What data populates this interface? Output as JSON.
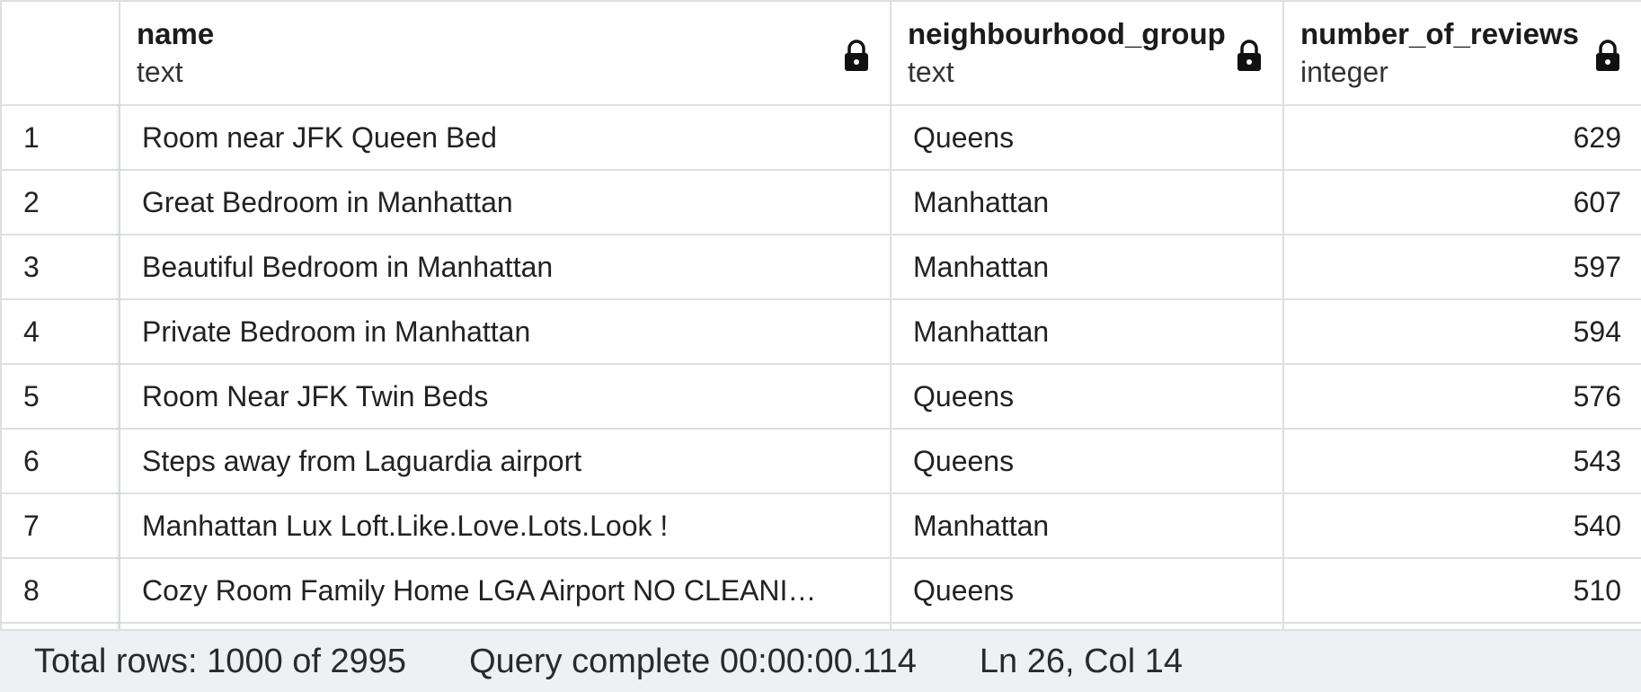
{
  "columns": [
    {
      "name": "name",
      "type": "text",
      "icon": "lock-icon"
    },
    {
      "name": "neighbourhood_group",
      "type": "text",
      "icon": "lock-icon"
    },
    {
      "name": "number_of_reviews",
      "type": "integer",
      "icon": "lock-icon"
    }
  ],
  "rows": [
    {
      "num": "1",
      "name": "Room near JFK Queen Bed",
      "neighbourhood_group": "Queens",
      "number_of_reviews": "629"
    },
    {
      "num": "2",
      "name": "Great Bedroom in Manhattan",
      "neighbourhood_group": "Manhattan",
      "number_of_reviews": "607"
    },
    {
      "num": "3",
      "name": "Beautiful Bedroom in Manhattan",
      "neighbourhood_group": "Manhattan",
      "number_of_reviews": "597"
    },
    {
      "num": "4",
      "name": "Private Bedroom in Manhattan",
      "neighbourhood_group": "Manhattan",
      "number_of_reviews": "594"
    },
    {
      "num": "5",
      "name": "Room Near JFK Twin Beds",
      "neighbourhood_group": "Queens",
      "number_of_reviews": "576"
    },
    {
      "num": "6",
      "name": "Steps away from Laguardia airport",
      "neighbourhood_group": "Queens",
      "number_of_reviews": "543"
    },
    {
      "num": "7",
      "name": "Manhattan Lux Loft.Like.Love.Lots.Look !",
      "neighbourhood_group": "Manhattan",
      "number_of_reviews": "540"
    },
    {
      "num": "8",
      "name": "Cozy Room Family Home LGA Airport NO CLEANI…",
      "neighbourhood_group": "Queens",
      "number_of_reviews": "510"
    }
  ],
  "status": {
    "total_rows": "Total rows: 1000 of 2995",
    "query": "Query complete 00:00:00.114",
    "cursor": "Ln 26, Col 14"
  },
  "colors": {
    "grid_border": "#dcdfe3",
    "status_bg": "#eef0f3"
  }
}
